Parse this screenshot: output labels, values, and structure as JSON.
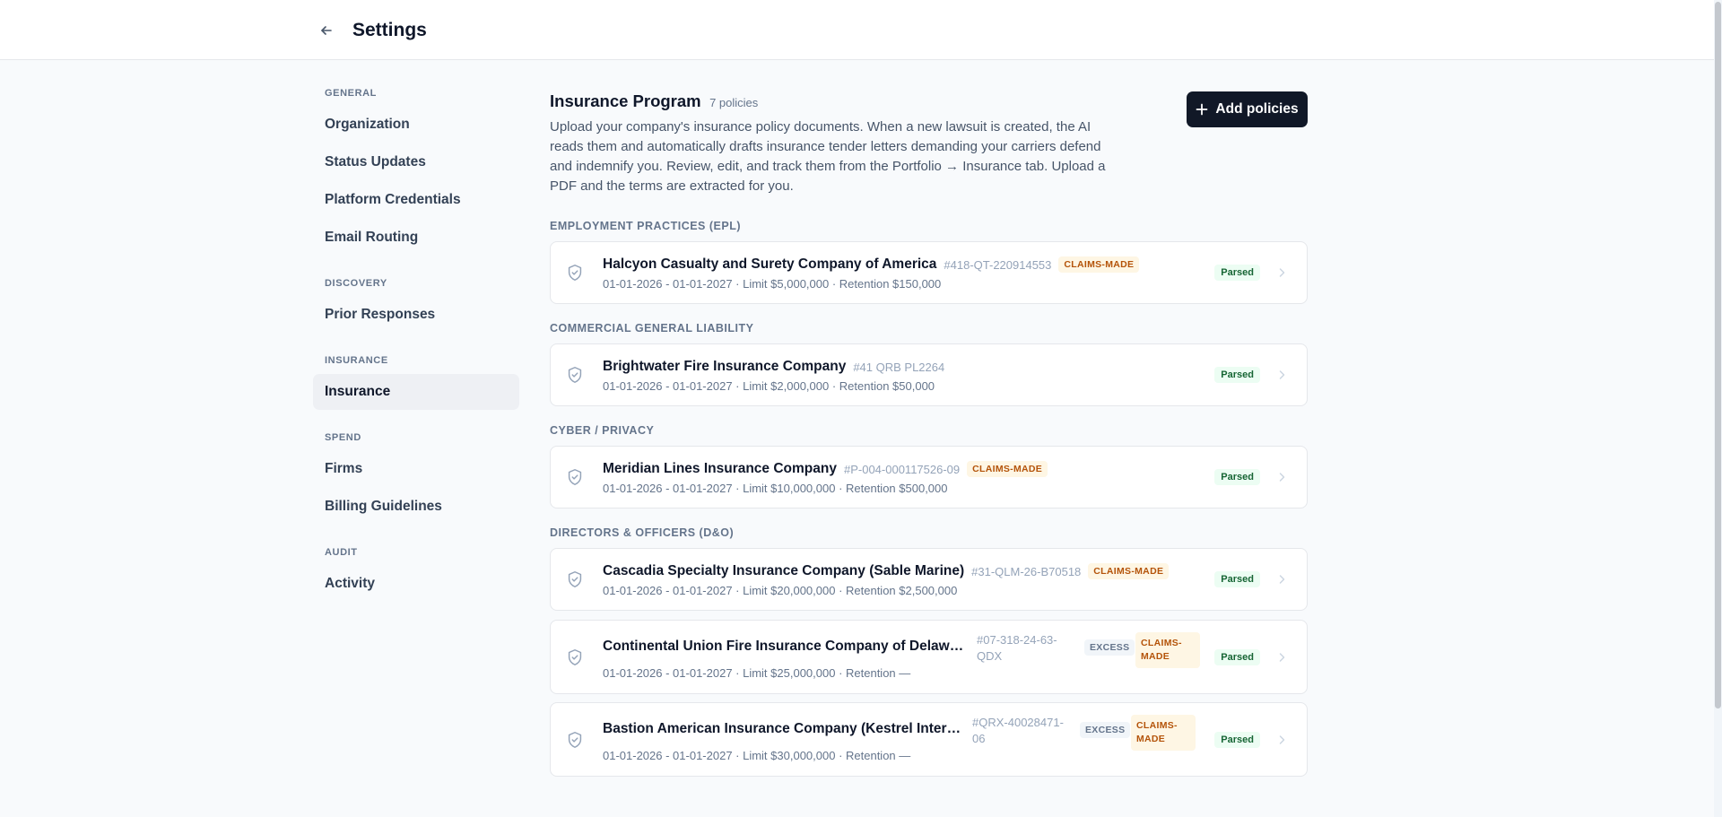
{
  "header": {
    "title": "Settings"
  },
  "sidebar": {
    "groups": [
      {
        "label": "GENERAL",
        "items": [
          "Organization",
          "Status Updates",
          "Platform Credentials",
          "Email Routing"
        ]
      },
      {
        "label": "DISCOVERY",
        "items": [
          "Prior Responses"
        ]
      },
      {
        "label": "INSURANCE",
        "items": [
          "Insurance"
        ]
      },
      {
        "label": "SPEND",
        "items": [
          "Firms",
          "Billing Guidelines"
        ]
      },
      {
        "label": "AUDIT",
        "items": [
          "Activity"
        ]
      }
    ],
    "active_item": "Insurance"
  },
  "main": {
    "title": "Insurance Program",
    "count": "7 policies",
    "description": "Upload your company's insurance policy documents. When a new lawsuit is created, the AI reads them and automatically drafts insurance tender letters demanding your carriers defend and indemnify you. Review, edit, and track them from the Portfolio → Insurance tab. Upload a PDF and the terms are extracted for you.",
    "add_button_label": "Add policies"
  },
  "sections": [
    {
      "label": "EMPLOYMENT PRACTICES (EPL)",
      "policies": [
        {
          "name": "Halcyon Casualty and Surety Company of America",
          "number": "#418-QT-220914553",
          "claims_made": "CLAIMS-MADE",
          "meta": "01-01-2026 - 01-01-2027 · Limit $5,000,000 · Retention $150,000",
          "status": "Parsed"
        }
      ]
    },
    {
      "label": "COMMERCIAL GENERAL LIABILITY",
      "policies": [
        {
          "name": "Brightwater Fire Insurance Company",
          "number": "#41 QRB PL2264",
          "meta": "01-01-2026 - 01-01-2027 · Limit $2,000,000 · Retention $50,000",
          "status": "Parsed"
        }
      ]
    },
    {
      "label": "CYBER / PRIVACY",
      "policies": [
        {
          "name": "Meridian Lines Insurance Company",
          "number": "#P-004-000117526-09",
          "claims_made": "CLAIMS-MADE",
          "meta": "01-01-2026 - 01-01-2027 · Limit $10,000,000 · Retention $500,000",
          "status": "Parsed"
        }
      ]
    },
    {
      "label": "DIRECTORS & OFFICERS (D&O)",
      "policies": [
        {
          "name": "Cascadia Specialty Insurance Company (Sable Marine)",
          "number": "#31-QLM-26-B70518",
          "claims_made": "CLAIMS-MADE",
          "meta": "01-01-2026 - 01-01-2027 · Limit $20,000,000 · Retention $2,500,000",
          "status": "Parsed"
        },
        {
          "name": "Continental Union Fire Insurance Company of Delaware (...",
          "number_line1": "#07-318-24-63-",
          "number_line2": "QDX",
          "excess": "EXCESS",
          "claims_line1": "CLAIMS-",
          "claims_line2": "MADE",
          "meta": "01-01-2026 - 01-01-2027 · Limit $25,000,000 · Retention —",
          "status": "Parsed"
        },
        {
          "name": "Bastion American Insurance Company (Kestrel Internati...",
          "number_line1": "#QRX-40028471-",
          "number_line2": "06",
          "excess": "EXCESS",
          "claims_line1": "CLAIMS-",
          "claims_line2": "MADE",
          "meta": "01-01-2026 - 01-01-2027 · Limit $30,000,000 · Retention —",
          "status": "Parsed"
        }
      ]
    }
  ]
}
